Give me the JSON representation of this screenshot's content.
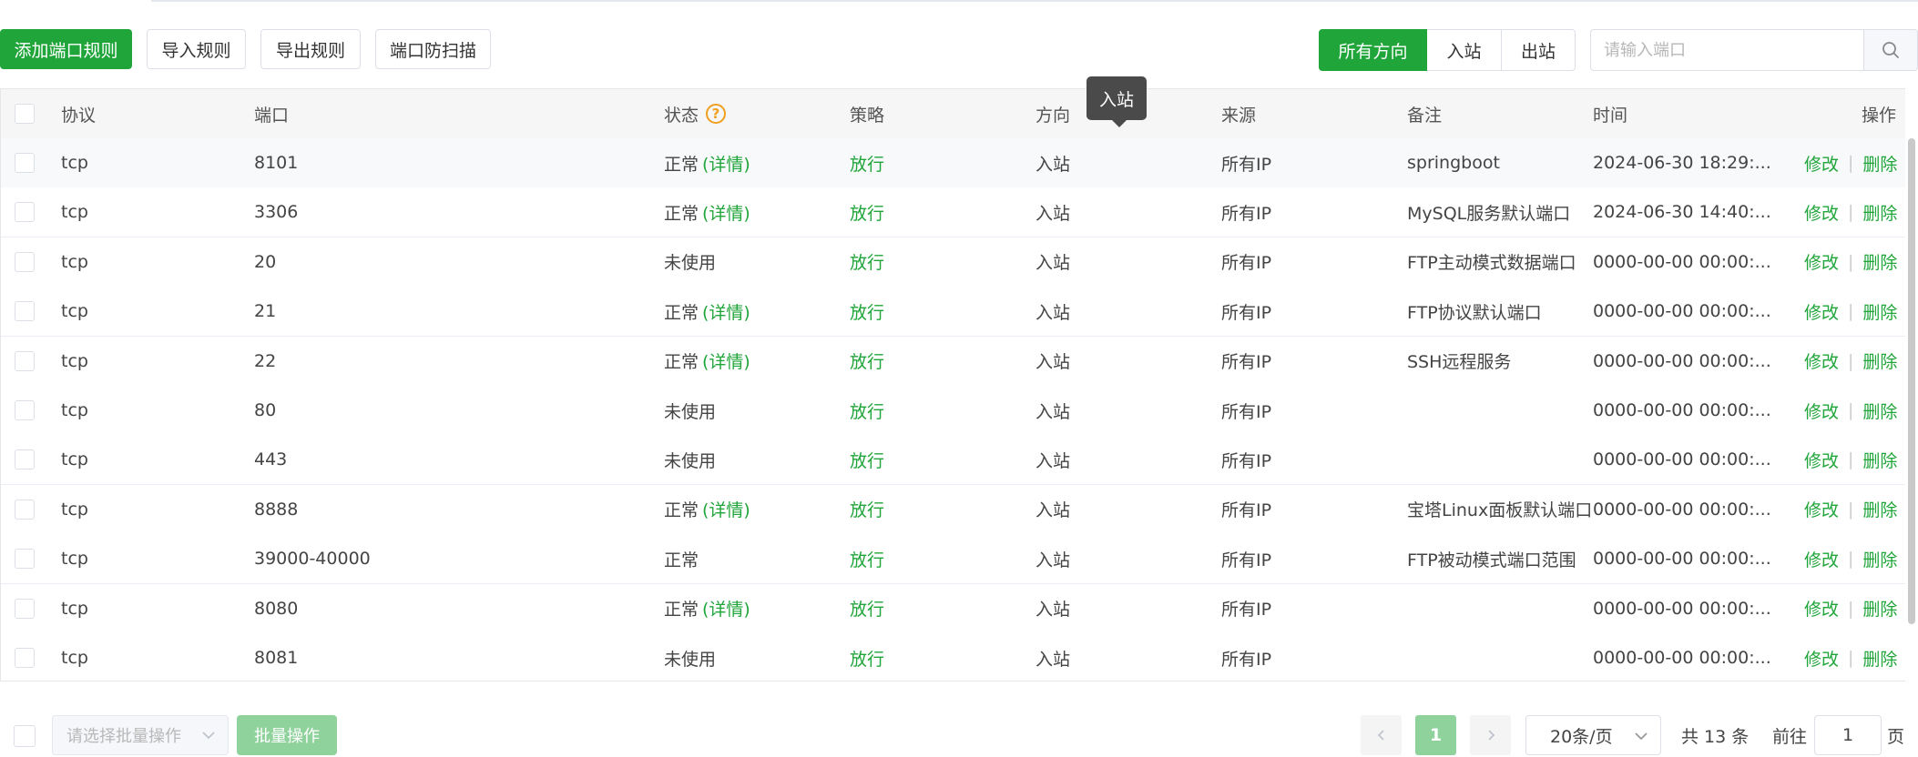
{
  "toolbar": {
    "add_rule": "添加端口规则",
    "import_rule": "导入规则",
    "export_rule": "导出规则",
    "port_scan": "端口防扫描",
    "direction_tabs": [
      {
        "label": "所有方向",
        "active": true
      },
      {
        "label": "入站",
        "active": false
      },
      {
        "label": "出站",
        "active": false
      }
    ],
    "search_placeholder": "请输入端口",
    "search_icon": "search-icon"
  },
  "tooltip": {
    "text": "入站"
  },
  "table": {
    "columns": {
      "protocol": "协议",
      "port": "端口",
      "status": "状态",
      "policy": "策略",
      "direction": "方向",
      "source": "来源",
      "remark": "备注",
      "time": "时间",
      "actions": "操作"
    },
    "detail_label": "(详情)",
    "edit_label": "修改",
    "delete_label": "删除",
    "rows": [
      {
        "protocol": "tcp",
        "port": "8101",
        "status": "正常",
        "has_detail": true,
        "policy": "放行",
        "direction": "入站",
        "source": "所有IP",
        "remark": "springboot",
        "time": "2024-06-30 18:29:..."
      },
      {
        "protocol": "tcp",
        "port": "3306",
        "status": "正常",
        "has_detail": true,
        "policy": "放行",
        "direction": "入站",
        "source": "所有IP",
        "remark": "MySQL服务默认端口",
        "time": "2024-06-30 14:40:..."
      },
      {
        "protocol": "tcp",
        "port": "20",
        "status": "未使用",
        "has_detail": false,
        "policy": "放行",
        "direction": "入站",
        "source": "所有IP",
        "remark": "FTP主动模式数据端口",
        "time": "0000-00-00 00:00:..."
      },
      {
        "protocol": "tcp",
        "port": "21",
        "status": "正常",
        "has_detail": true,
        "policy": "放行",
        "direction": "入站",
        "source": "所有IP",
        "remark": "FTP协议默认端口",
        "time": "0000-00-00 00:00:..."
      },
      {
        "protocol": "tcp",
        "port": "22",
        "status": "正常",
        "has_detail": true,
        "policy": "放行",
        "direction": "入站",
        "source": "所有IP",
        "remark": "SSH远程服务",
        "time": "0000-00-00 00:00:..."
      },
      {
        "protocol": "tcp",
        "port": "80",
        "status": "未使用",
        "has_detail": false,
        "policy": "放行",
        "direction": "入站",
        "source": "所有IP",
        "remark": "",
        "time": "0000-00-00 00:00:..."
      },
      {
        "protocol": "tcp",
        "port": "443",
        "status": "未使用",
        "has_detail": false,
        "policy": "放行",
        "direction": "入站",
        "source": "所有IP",
        "remark": "",
        "time": "0000-00-00 00:00:..."
      },
      {
        "protocol": "tcp",
        "port": "8888",
        "status": "正常",
        "has_detail": true,
        "policy": "放行",
        "direction": "入站",
        "source": "所有IP",
        "remark": "宝塔Linux面板默认端口",
        "time": "0000-00-00 00:00:..."
      },
      {
        "protocol": "tcp",
        "port": "39000-40000",
        "status": "正常",
        "has_detail": false,
        "policy": "放行",
        "direction": "入站",
        "source": "所有IP",
        "remark": "FTP被动模式端口范围",
        "time": "0000-00-00 00:00:..."
      },
      {
        "protocol": "tcp",
        "port": "8080",
        "status": "正常",
        "has_detail": true,
        "policy": "放行",
        "direction": "入站",
        "source": "所有IP",
        "remark": "",
        "time": "0000-00-00 00:00:..."
      },
      {
        "protocol": "tcp",
        "port": "8081",
        "status": "未使用",
        "has_detail": false,
        "policy": "放行",
        "direction": "入站",
        "source": "所有IP",
        "remark": "",
        "time": "0000-00-00 00:00:..."
      }
    ]
  },
  "footer": {
    "batch_placeholder": "请选择批量操作",
    "batch_button": "批量操作",
    "prev_icon": "chevron-left-icon",
    "next_icon": "chevron-right-icon",
    "current_page": "1",
    "page_size": "20条/页",
    "total": "共 13 条",
    "goto_label": "前往",
    "goto_value": "1",
    "page_suffix": "页"
  },
  "colors": {
    "accent": "#20a53a",
    "accent_light": "#8fd29c",
    "warning": "#f0a020"
  }
}
